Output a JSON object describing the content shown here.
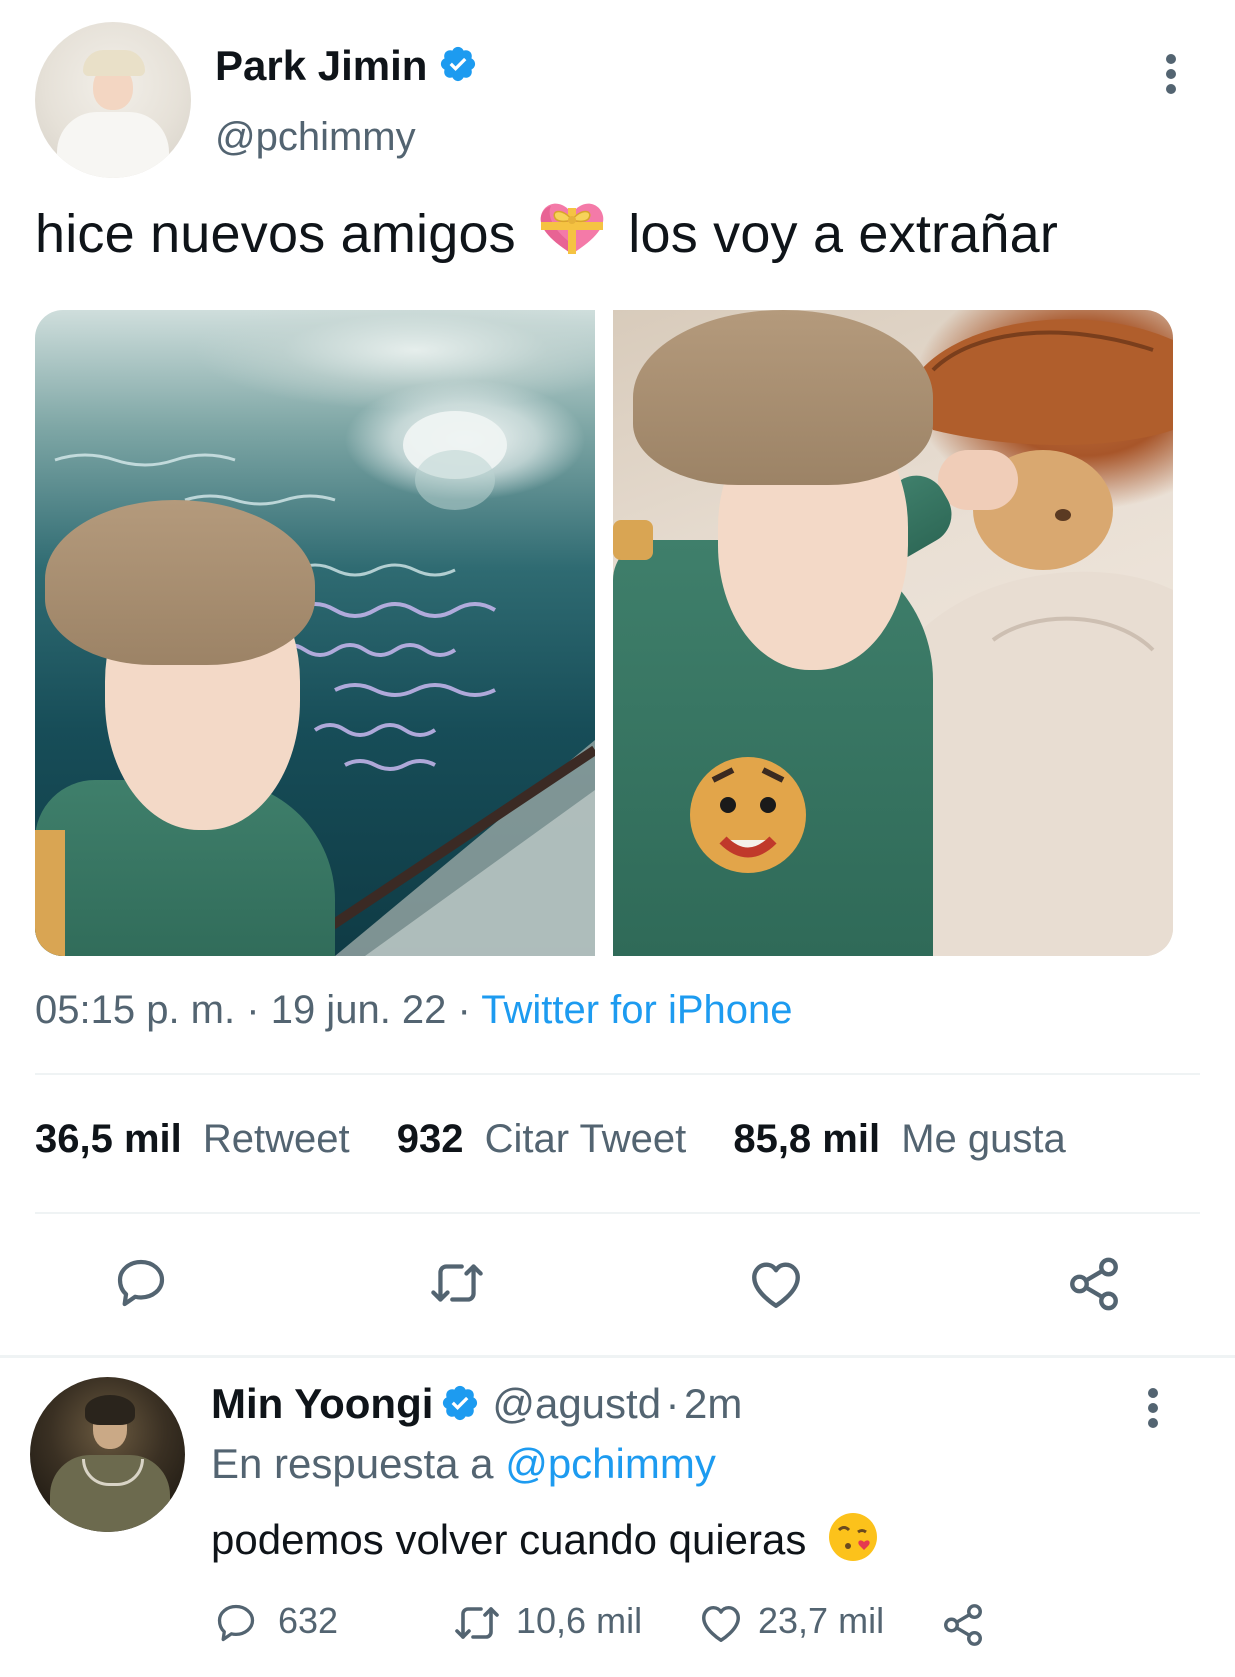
{
  "main_tweet": {
    "author_name": "Park Jimin",
    "author_handle": "@pchimmy",
    "text_before_emoji": "hice nuevos amigos",
    "emoji": "heart-with-ribbon",
    "text_after_emoji": "los voy a extrañar",
    "time": "05:15 p. m.",
    "separator": "·",
    "date": "19 jun. 22",
    "source": "Twitter for iPhone",
    "stats": {
      "retweets_count": "36,5 mil",
      "retweets_label": "Retweet",
      "quotes_count": "932",
      "quotes_label": "Citar Tweet",
      "likes_count": "85,8 mil",
      "likes_label": "Me gusta"
    },
    "actions": [
      "reply-icon",
      "retweet-icon",
      "like-icon",
      "share-icon"
    ]
  },
  "reply_tweet": {
    "author_name": "Min Yoongi",
    "author_handle": "@agustd",
    "separator": "·",
    "time_ago": "2m",
    "replying_to_label": "En respuesta a",
    "replying_to_handle": "@pchimmy",
    "text": "podemos volver cuando quieras",
    "emoji": "face-blowing-a-kiss",
    "replies": "632",
    "retweets": "10,6 mil",
    "likes": "23,7 mil"
  },
  "colors": {
    "link": "#1d9bf0",
    "secondary_text": "#536471",
    "primary_text": "#0f1419",
    "verified_badge": "#1d9bf0",
    "divider": "#eff3f4"
  }
}
